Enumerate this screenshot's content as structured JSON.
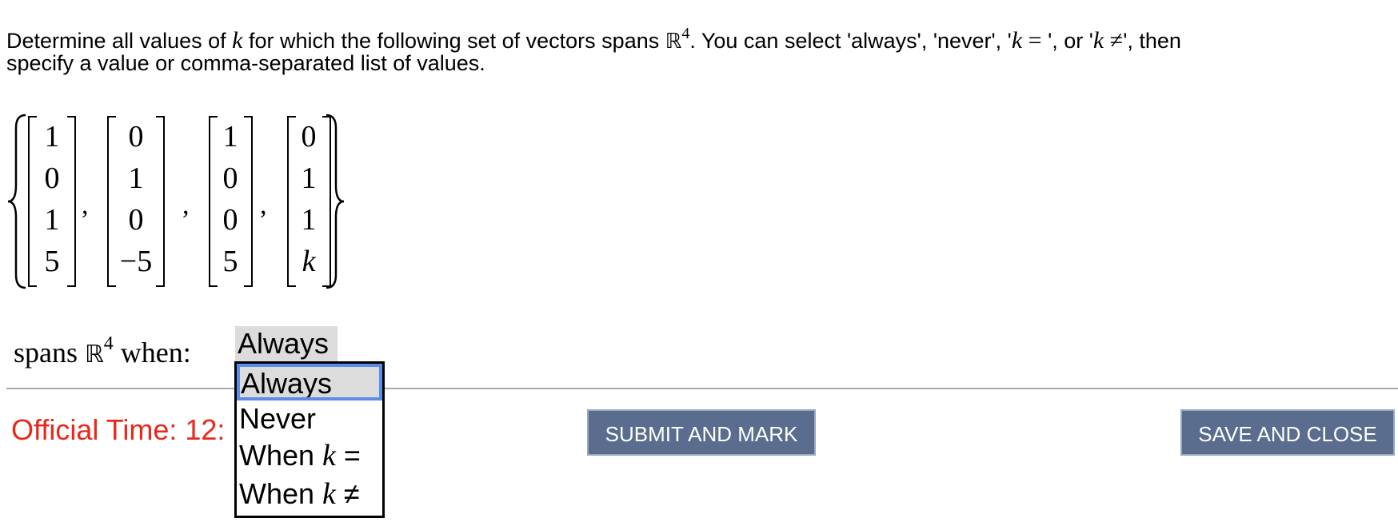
{
  "question": {
    "line1_part1": "Determine all values of ",
    "k_symbol": "k",
    "line1_part2": " for which the following set of vectors spans ",
    "space_symbol": "ℝ",
    "space_dim": "4",
    "line1_part3": ". You can select 'always', 'never', '",
    "k_eq_symbol": "k",
    "eq_sign": " = ",
    "line1_part4": "', or '",
    "k_neq_symbol": "k",
    "neq_sign": " ≠",
    "line1_part5": "', then",
    "line2": "specify a value or comma-separated list of values."
  },
  "vectors": [
    [
      "1",
      "0",
      "1",
      "5"
    ],
    [
      "0",
      "1",
      "0",
      "−5"
    ],
    [
      "1",
      "0",
      "0",
      "5"
    ],
    [
      "0",
      "1",
      "1",
      "k"
    ]
  ],
  "comma_symbol": ",",
  "spans": {
    "label_before": "spans ",
    "space_symbol": "ℝ",
    "space_dim": "4",
    "label_after": " when:",
    "selected_value": "Always"
  },
  "dropdown": {
    "options": [
      {
        "prefix": "Always",
        "k": "",
        "suffix": ""
      },
      {
        "prefix": "Never",
        "k": "",
        "suffix": ""
      },
      {
        "prefix": "When ",
        "k": "k",
        "suffix": " ="
      },
      {
        "prefix": "When ",
        "k": "k",
        "suffix": " ≠"
      }
    ],
    "highlighted_index": 0
  },
  "footer": {
    "official_time": "Official Time: 12:",
    "submit_label": "SUBMIT AND MARK",
    "save_label": "SAVE AND CLOSE"
  },
  "colors": {
    "time_text": "#e8281c",
    "button_bg": "#5b6d8e",
    "button_border": "#9aa8c2",
    "selected_bg": "#dcdcdc",
    "focus_ring": "#5b8de8"
  }
}
